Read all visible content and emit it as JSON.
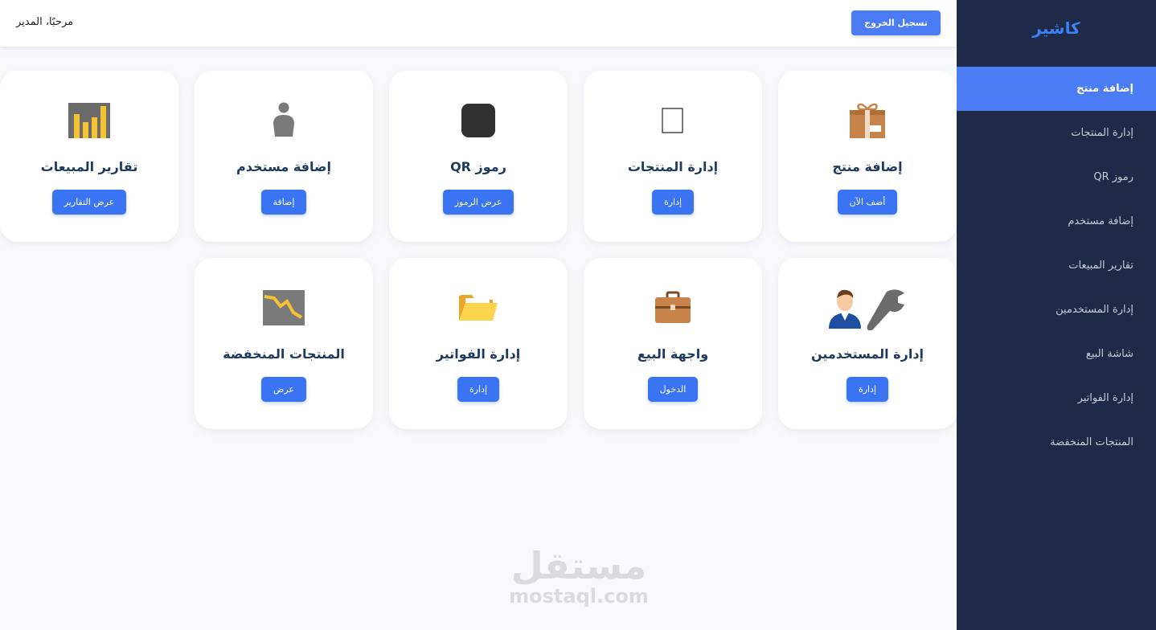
{
  "sidebar": {
    "brand": "كاشير",
    "items": [
      {
        "label": "إضافة منتج",
        "active": true
      },
      {
        "label": "إدارة المنتجات"
      },
      {
        "label": "رموز QR"
      },
      {
        "label": "إضافة مستخدم"
      },
      {
        "label": "تقارير المبيعات"
      },
      {
        "label": "إدارة المستخدمين"
      },
      {
        "label": "شاشة البيع"
      },
      {
        "label": "إدارة الفواتير"
      },
      {
        "label": "المنتجات المنخفضة"
      }
    ]
  },
  "header": {
    "logout_label": "تسجيل الخروج",
    "welcome": "مرحبًا، المدير"
  },
  "cards": [
    {
      "title": "إضافة منتج",
      "button": "أضف الآن",
      "icon": "gift-box-icon"
    },
    {
      "title": "إدارة المنتجات",
      "button": "إدارة",
      "icon": "blank-box-icon"
    },
    {
      "title": "رموز QR",
      "button": "عرض الرموز",
      "icon": "qr-square-icon"
    },
    {
      "title": "إضافة مستخدم",
      "button": "إضافة",
      "icon": "user-icon"
    },
    {
      "title": "تقارير المبيعات",
      "button": "عرض التقارير",
      "icon": "bar-chart-icon"
    },
    {
      "title": "إدارة المستخدمين",
      "button": "إدارة",
      "icon": "user-wrench-icon"
    },
    {
      "title": "واجهة البيع",
      "button": "الدخول",
      "icon": "briefcase-icon"
    },
    {
      "title": "إدارة الفواتير",
      "button": "إدارة",
      "icon": "folder-icon"
    },
    {
      "title": "المنتجات المنخفضة",
      "button": "عرض",
      "icon": "declining-chart-icon"
    }
  ],
  "watermark": {
    "arabic": "مستقل",
    "latin": "mostaql.com"
  },
  "colors": {
    "sidebar_bg": "#1e2a47",
    "accent": "#4c7cf3",
    "brand": "#3b82f6",
    "card_title": "#1e3a5f"
  }
}
